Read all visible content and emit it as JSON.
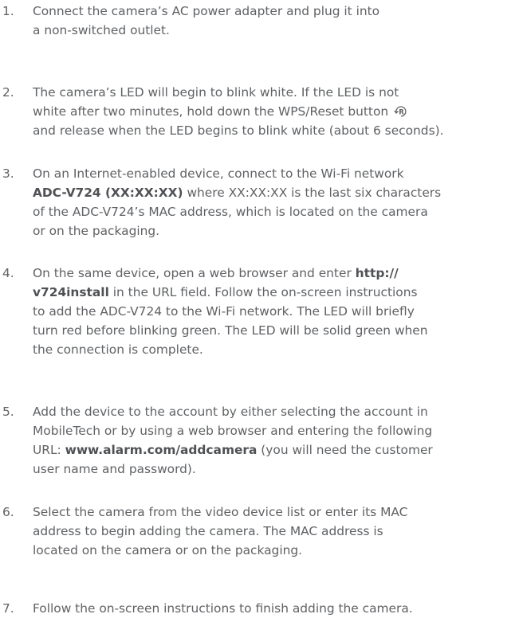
{
  "steps": [
    {
      "number": "1.",
      "lines": [
        [
          {
            "t": "Connect the camera’s AC power adapter and plug it into"
          }
        ],
        [
          {
            "t": "a non-switched outlet."
          }
        ]
      ]
    },
    {
      "number": "2.",
      "lines": [
        [
          {
            "t": "The camera’s LED will begin to blink white. If the LED is not"
          }
        ],
        [
          {
            "t": "white after two minutes, hold down the WPS/Reset button "
          },
          {
            "icon": "reset-button-icon"
          }
        ],
        [
          {
            "t": "and release when the LED begins to blink white (about 6 seconds)."
          }
        ]
      ]
    },
    {
      "number": "3.",
      "lines": [
        [
          {
            "t": "On an Internet-enabled device, connect to the Wi-Fi network"
          }
        ],
        [
          {
            "t": "ADC-V724 (XX:XX:XX)",
            "b": true
          },
          {
            "t": " where XX:XX:XX is the last six characters"
          }
        ],
        [
          {
            "t": "of the ADC-V724’s MAC address, which is located on the camera"
          }
        ],
        [
          {
            "t": "or on the packaging."
          }
        ]
      ]
    },
    {
      "number": "4.",
      "lines": [
        [
          {
            "t": "On the same device, open a web browser and enter "
          },
          {
            "t": "http://",
            "b": true
          }
        ],
        [
          {
            "t": "v724install",
            "b": true
          },
          {
            "t": " in the URL field. Follow the on-screen instructions"
          }
        ],
        [
          {
            "t": "to add the ADC-V724 to the Wi-Fi network. The LED will briefly"
          }
        ],
        [
          {
            "t": "turn red before blinking green. The LED will be solid green when"
          }
        ],
        [
          {
            "t": "the connection is complete."
          }
        ]
      ]
    },
    {
      "number": "5.",
      "lines": [
        [
          {
            "t": "Add the device to the account by either selecting the account in"
          }
        ],
        [
          {
            "t": "MobileTech or by using a web browser and entering the following"
          }
        ],
        [
          {
            "t": "URL: "
          },
          {
            "t": "www.alarm.com/addcamera",
            "b": true
          },
          {
            "t": " (you will need the customer"
          }
        ],
        [
          {
            "t": "user name and password)."
          }
        ]
      ]
    },
    {
      "number": "6.",
      "lines": [
        [
          {
            "t": "Select the camera from the video device list or enter its MAC"
          }
        ],
        [
          {
            "t": "address to begin adding the camera. The MAC address is"
          }
        ],
        [
          {
            "t": "located on the camera or on the packaging."
          }
        ]
      ]
    },
    {
      "number": "7.",
      "lines": [
        [
          {
            "t": "Follow the on-screen instructions to finish adding the camera."
          }
        ]
      ]
    }
  ],
  "colors": {
    "text": "#5f6164",
    "bold": "#4f5154"
  }
}
